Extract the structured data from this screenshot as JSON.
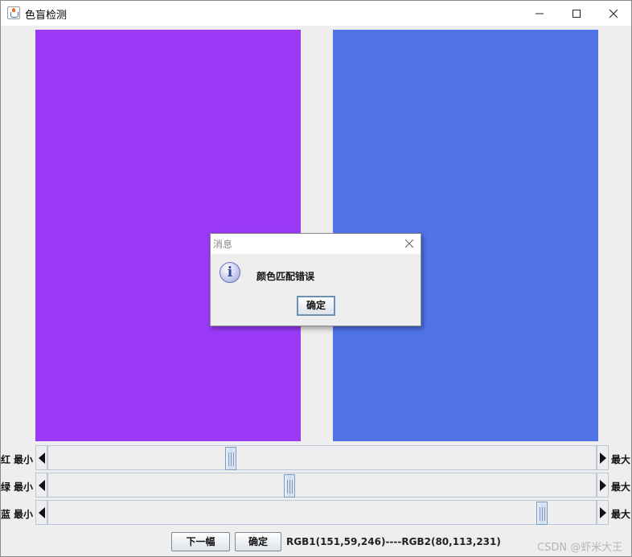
{
  "window": {
    "title": "色盲检测",
    "icon": "java-cup-icon",
    "controls": [
      "minimize-icon",
      "maximize-icon",
      "close-icon"
    ]
  },
  "swatches": {
    "left_color": "#9a3af7",
    "right_color": "#5073e7"
  },
  "sliders": [
    {
      "channel_label": "红",
      "min_label": "最小",
      "max_label": "最大",
      "value_fraction": 0.33
    },
    {
      "channel_label": "绿",
      "min_label": "最小",
      "max_label": "最大",
      "value_fraction": 0.44
    },
    {
      "channel_label": "蓝",
      "min_label": "最小",
      "max_label": "最大",
      "value_fraction": 0.91
    }
  ],
  "bottom_bar": {
    "next_button": "下一幅",
    "confirm_button": "确定",
    "rgb_readout": "RGB1(151,59,246)----RGB2(80,113,231)"
  },
  "watermark": "CSDN @虾米大王",
  "dialog": {
    "title": "消息",
    "icon": "info-icon",
    "message": "颜色匹配错误",
    "ok_button": "确定"
  }
}
